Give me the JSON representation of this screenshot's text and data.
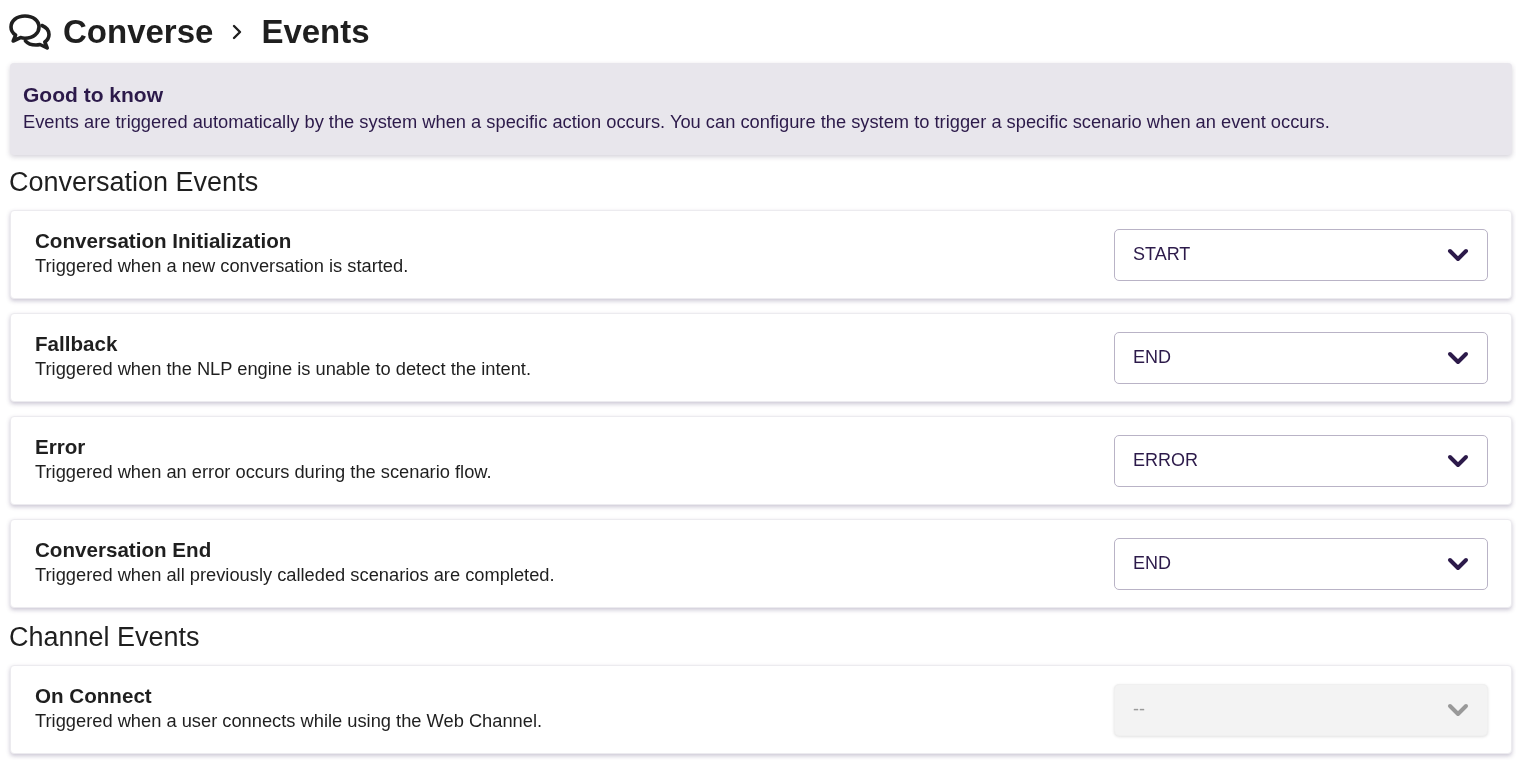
{
  "breadcrumb": [
    {
      "label": "Converse"
    },
    {
      "label": "Events"
    }
  ],
  "info": {
    "title": "Good to know",
    "text": "Events are triggered automatically by the system when a specific action occurs. You can configure the system to trigger a specific scenario when an event occurs."
  },
  "sections": [
    {
      "title": "Conversation Events",
      "events": [
        {
          "name": "Conversation Initialization",
          "description": "Triggered when a new conversation is started.",
          "value": "START",
          "disabled": false
        },
        {
          "name": "Fallback",
          "description": "Triggered when the NLP engine is unable to detect the intent.",
          "value": "END",
          "disabled": false
        },
        {
          "name": "Error",
          "description": "Triggered when an error occurs during the scenario flow.",
          "value": "ERROR",
          "disabled": false
        },
        {
          "name": "Conversation End",
          "description": "Triggered when all previously calleded scenarios are completed.",
          "value": "END",
          "disabled": false
        }
      ]
    },
    {
      "title": "Channel Events",
      "events": [
        {
          "name": "On Connect",
          "description": "Triggered when a user connects while using the Web Channel.",
          "value": "--",
          "disabled": true
        }
      ]
    }
  ]
}
